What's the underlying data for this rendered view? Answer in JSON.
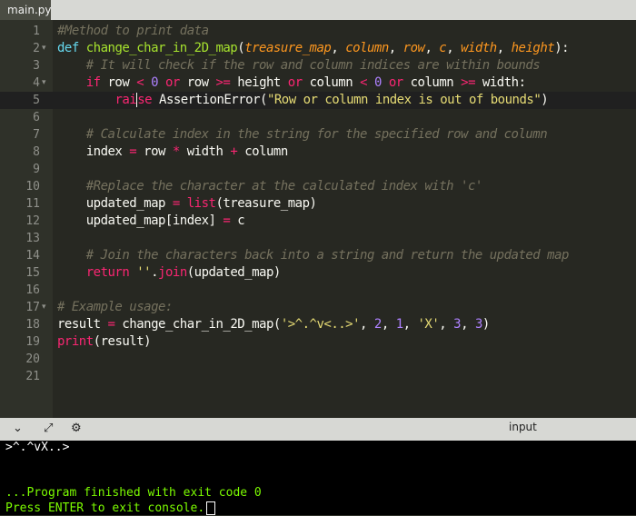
{
  "tab": {
    "label": "main.py"
  },
  "editor": {
    "lines": [
      {
        "num": "1",
        "parts": [
          [
            "c",
            "#Method to print data"
          ]
        ]
      },
      {
        "num": "2",
        "fold": true,
        "parts": [
          [
            "kw",
            "def"
          ],
          [
            "",
            " "
          ],
          [
            "f",
            "change_char_in_2D_map"
          ],
          [
            "",
            "("
          ],
          [
            "p",
            "treasure_map"
          ],
          [
            "",
            ", "
          ],
          [
            "p",
            "column"
          ],
          [
            "",
            ", "
          ],
          [
            "p",
            "row"
          ],
          [
            "",
            ", "
          ],
          [
            "p",
            "c"
          ],
          [
            "",
            ", "
          ],
          [
            "p",
            "width"
          ],
          [
            "",
            ", "
          ],
          [
            "p",
            "height"
          ],
          [
            "",
            "):"
          ]
        ]
      },
      {
        "num": "3",
        "parts": [
          [
            "",
            "    "
          ],
          [
            "c",
            "# It will check if the row and column indices are within bounds"
          ]
        ]
      },
      {
        "num": "4",
        "fold": true,
        "parts": [
          [
            "",
            "    "
          ],
          [
            "k",
            "if"
          ],
          [
            "",
            " row "
          ],
          [
            "o",
            "<"
          ],
          [
            "",
            " "
          ],
          [
            "n",
            "0"
          ],
          [
            "",
            " "
          ],
          [
            "k",
            "or"
          ],
          [
            "",
            " row "
          ],
          [
            "o",
            ">="
          ],
          [
            "",
            " height "
          ],
          [
            "k",
            "or"
          ],
          [
            "",
            " column "
          ],
          [
            "o",
            "<"
          ],
          [
            "",
            " "
          ],
          [
            "n",
            "0"
          ],
          [
            "",
            " "
          ],
          [
            "k",
            "or"
          ],
          [
            "",
            " column "
          ],
          [
            "o",
            ">="
          ],
          [
            "",
            " width:"
          ]
        ]
      },
      {
        "num": "5",
        "active": true,
        "parts": [
          [
            "",
            "        "
          ],
          [
            "k",
            "rai"
          ],
          [
            "cursor",
            ""
          ],
          [
            "k",
            "se"
          ],
          [
            "",
            " AssertionError("
          ],
          [
            "s",
            "\"Row or column index is out of bounds\""
          ],
          [
            "",
            ")"
          ]
        ]
      },
      {
        "num": "6",
        "parts": []
      },
      {
        "num": "7",
        "parts": [
          [
            "",
            "    "
          ],
          [
            "c",
            "# Calculate index in the string for the specified row and column"
          ]
        ]
      },
      {
        "num": "8",
        "parts": [
          [
            "",
            "    index "
          ],
          [
            "o",
            "="
          ],
          [
            "",
            " row "
          ],
          [
            "o",
            "*"
          ],
          [
            "",
            " width "
          ],
          [
            "o",
            "+"
          ],
          [
            "",
            " column"
          ]
        ]
      },
      {
        "num": "9",
        "parts": []
      },
      {
        "num": "10",
        "parts": [
          [
            "",
            "    "
          ],
          [
            "c",
            "#Replace the character at the calculated index with 'c'"
          ]
        ]
      },
      {
        "num": "11",
        "parts": [
          [
            "",
            "    updated_map "
          ],
          [
            "o",
            "="
          ],
          [
            "",
            " "
          ],
          [
            "k",
            "list"
          ],
          [
            "",
            "(treasure_map)"
          ]
        ]
      },
      {
        "num": "12",
        "parts": [
          [
            "",
            "    updated_map[index] "
          ],
          [
            "o",
            "="
          ],
          [
            "",
            " c"
          ]
        ]
      },
      {
        "num": "13",
        "parts": []
      },
      {
        "num": "14",
        "parts": [
          [
            "",
            "    "
          ],
          [
            "c",
            "# Join the characters back into a string and return the updated map"
          ]
        ]
      },
      {
        "num": "15",
        "parts": [
          [
            "",
            "    "
          ],
          [
            "k",
            "return"
          ],
          [
            "",
            " "
          ],
          [
            "s",
            "''"
          ],
          [
            "",
            "."
          ],
          [
            "k",
            "join"
          ],
          [
            "",
            "(updated_map)"
          ]
        ]
      },
      {
        "num": "16",
        "parts": []
      },
      {
        "num": "17",
        "fold": true,
        "parts": [
          [
            "c",
            "# Example usage:"
          ]
        ]
      },
      {
        "num": "18",
        "parts": [
          [
            "",
            "result "
          ],
          [
            "o",
            "="
          ],
          [
            "",
            " change_char_in_2D_map("
          ],
          [
            "s",
            "'>^.^v<..>'"
          ],
          [
            "",
            ", "
          ],
          [
            "n",
            "2"
          ],
          [
            "",
            ", "
          ],
          [
            "n",
            "1"
          ],
          [
            "",
            ", "
          ],
          [
            "s",
            "'X'"
          ],
          [
            "",
            ", "
          ],
          [
            "n",
            "3"
          ],
          [
            "",
            ", "
          ],
          [
            "n",
            "3"
          ],
          [
            "",
            ")"
          ]
        ]
      },
      {
        "num": "19",
        "parts": [
          [
            "k",
            "print"
          ],
          [
            "",
            "(result)"
          ]
        ]
      },
      {
        "num": "20",
        "parts": []
      },
      {
        "num": "21",
        "parts": []
      }
    ]
  },
  "toolbar": {
    "icons": [
      "chevron-down-icon",
      "expand-icon",
      "gear-icon"
    ],
    "input_label": "input"
  },
  "console": {
    "output": ">^.^vX..>",
    "finished": "...Program finished with exit code 0",
    "prompt": "Press ENTER to exit console."
  }
}
